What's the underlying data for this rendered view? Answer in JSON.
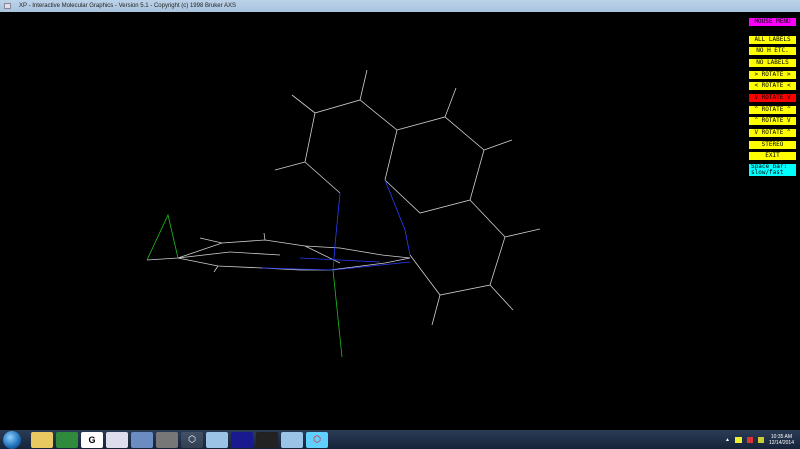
{
  "window": {
    "title": "XP - Interactive Molecular Graphics - Version 5.1 - Copyright (c) 1998 Bruker AXS"
  },
  "menu": [
    {
      "label": "MOUSE MENU",
      "color": "#ff00ff"
    },
    {
      "label": "ALL LABELS",
      "color": "#ffff00"
    },
    {
      "label": "NO H ETC.",
      "color": "#ffff00"
    },
    {
      "label": "NO LABELS",
      "color": "#ffff00"
    },
    {
      "label": "> ROTATE >",
      "color": "#ffff00"
    },
    {
      "label": "< ROTATE <",
      "color": "#ffff00"
    },
    {
      "label": "V ROTATE V",
      "color": "#ff0000"
    },
    {
      "label": "^ ROTATE ^",
      "color": "#ffff00"
    },
    {
      "label": "^ ROTATE V",
      "color": "#ffff00"
    },
    {
      "label": "V ROTATE ^",
      "color": "#ffff00"
    },
    {
      "label": "STEREO",
      "color": "#ffff00"
    },
    {
      "label": "EXIT",
      "color": "#ffff00"
    }
  ],
  "hint": {
    "line1": "Space bar:",
    "line2": "slow/fast"
  },
  "taskbar": {
    "apps": [
      "explorer",
      "excel",
      "G",
      "app4",
      "app5",
      "app6",
      "app7",
      "app8",
      "app9",
      "app10",
      "app11",
      "xp"
    ],
    "time": "10:35 AM",
    "date": "12/14/2014",
    "tray_arrow": "▲"
  }
}
